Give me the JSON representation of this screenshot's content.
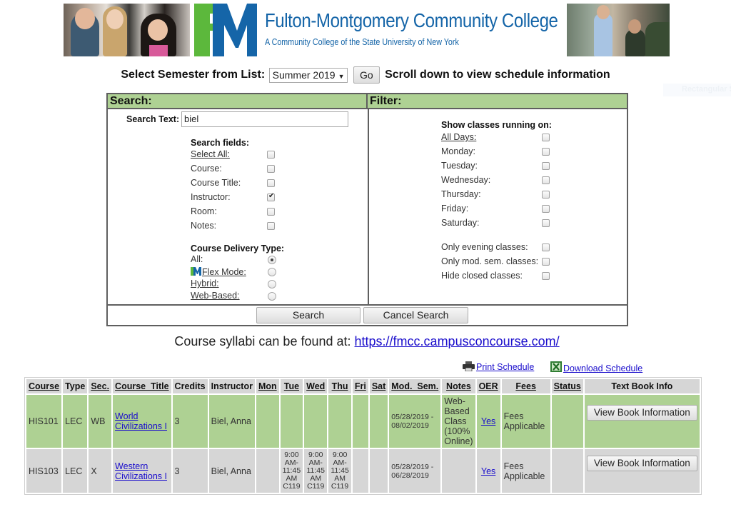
{
  "banner": {
    "title": "Fulton-Montgomery Community College",
    "subtitle": "A Community College of the State University of New York",
    "logo_letters": "FM",
    "colors": {
      "brand_blue": "#1565a8",
      "brand_green": "#5cb83c"
    }
  },
  "semester": {
    "label": "Select Semester from List:",
    "selected": "Summer 2019",
    "go_label": "Go",
    "hint": "Scroll down to view schedule information"
  },
  "overlay": {
    "snip_label": "Rectangular Snip"
  },
  "search": {
    "header": "Search:",
    "text_label": "Search Text:",
    "text_value": "biel",
    "fields_heading": "Search fields:",
    "fields": [
      {
        "label": "Select All:",
        "checked": false,
        "underline": true
      },
      {
        "label": "Course:",
        "checked": false
      },
      {
        "label": "Course Title:",
        "checked": false
      },
      {
        "label": "Instructor:",
        "checked": true
      },
      {
        "label": "Room:",
        "checked": false
      },
      {
        "label": "Notes:",
        "checked": false
      }
    ],
    "delivery_heading": "Course Delivery Type:",
    "delivery": [
      {
        "label": "All:",
        "selected": true,
        "link": false
      },
      {
        "label": "Flex Mode:",
        "selected": false,
        "link": true
      },
      {
        "label": "Hybrid:",
        "selected": false,
        "link": true
      },
      {
        "label": "Web-Based:",
        "selected": false,
        "link": true
      }
    ],
    "search_button": "Search",
    "cancel_button": "Cancel Search"
  },
  "filter": {
    "header": "Filter:",
    "days_heading": "Show classes running on:",
    "days": [
      {
        "label": "All Days:",
        "checked": false,
        "underline": true
      },
      {
        "label": "Monday:",
        "checked": false
      },
      {
        "label": "Tuesday:",
        "checked": false
      },
      {
        "label": "Wednesday:",
        "checked": false
      },
      {
        "label": "Thursday:",
        "checked": false
      },
      {
        "label": "Friday:",
        "checked": false
      },
      {
        "label": "Saturday:",
        "checked": false
      }
    ],
    "options": [
      {
        "label": "Only evening classes:",
        "checked": false
      },
      {
        "label": "Only mod. sem. classes:",
        "checked": false
      },
      {
        "label": "Hide closed classes:",
        "checked": false
      }
    ]
  },
  "syllabi": {
    "text": "Course syllabi can be found at:",
    "link": "https://fmcc.campusconcourse.com/"
  },
  "actions": {
    "print": "Print Schedule",
    "download": "Download Schedule"
  },
  "table": {
    "headers": [
      "Course",
      "Type",
      "Sec.",
      "Course_Title",
      "Credits",
      "Instructor",
      "Mon",
      "Tue",
      "Wed",
      "Thu",
      "Fri",
      "Sat",
      "Mod._Sem.",
      "Notes",
      "OER",
      "Fees",
      "Status",
      "Text Book Info"
    ],
    "rows": [
      {
        "course": "HIS101",
        "type": "LEC",
        "sec": "WB",
        "title_line1": "World",
        "title_line2": "Civilizations I",
        "credits": "3",
        "instructor": "Biel, Anna",
        "mon": "",
        "tue": "",
        "wed": "",
        "thu": "",
        "fri": "",
        "sat": "",
        "mod_sem_start": "05/28/2019 -",
        "mod_sem_end": "08/02/2019",
        "notes": [
          "Web-",
          "Based",
          "Class",
          "(100%",
          "Online)"
        ],
        "oer": "Yes",
        "fees_line1": "Fees",
        "fees_line2": "Applicable",
        "status": "",
        "textbook_button": "View Book Information",
        "row_color": "#aed193"
      },
      {
        "course": "HIS103",
        "type": "LEC",
        "sec": "X",
        "title_line1": "Western",
        "title_line2": "Civilizations I",
        "credits": "3",
        "instructor": "Biel, Anna",
        "mon": "",
        "tue": [
          "9:00",
          "AM-",
          "11:45",
          "AM",
          "C119"
        ],
        "wed": [
          "9:00",
          "AM-",
          "11:45",
          "AM",
          "C119"
        ],
        "thu": [
          "9:00",
          "AM-",
          "11:45",
          "AM",
          "C119"
        ],
        "fri": "",
        "sat": "",
        "mod_sem_start": "05/28/2019 -",
        "mod_sem_end": "06/28/2019",
        "notes": [],
        "oer": "Yes",
        "fees_line1": "Fees",
        "fees_line2": "Applicable",
        "status": "",
        "textbook_button": "View Book Information",
        "row_color": "#d6d6d6"
      }
    ]
  }
}
